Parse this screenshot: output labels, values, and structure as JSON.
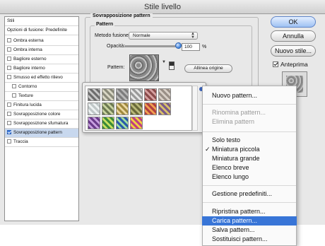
{
  "window": {
    "title": "Stile livello"
  },
  "left_panel": {
    "items": [
      {
        "label": "Stili",
        "checkbox": false,
        "checked": false
      },
      {
        "label": "Opzioni di fusione: Predefinite",
        "checkbox": false,
        "checked": false
      },
      {
        "label": "Ombra esterna",
        "checkbox": true,
        "checked": false
      },
      {
        "label": "Ombra interna",
        "checkbox": true,
        "checked": false
      },
      {
        "label": "Bagliore esterno",
        "checkbox": true,
        "checked": false
      },
      {
        "label": "Bagliore interno",
        "checkbox": true,
        "checked": false
      },
      {
        "label": "Smusso ed effetto rilievo",
        "checkbox": true,
        "checked": false
      },
      {
        "label": "Contorno",
        "checkbox": true,
        "checked": false
      },
      {
        "label": "Texture",
        "checkbox": true,
        "checked": false
      },
      {
        "label": "Finitura lucida",
        "checkbox": true,
        "checked": false
      },
      {
        "label": "Sovrapposizione colore",
        "checkbox": true,
        "checked": false
      },
      {
        "label": "Sovrapposizione sfumatura",
        "checkbox": true,
        "checked": false
      },
      {
        "label": "Sovrapposizione pattern",
        "checkbox": true,
        "checked": true
      },
      {
        "label": "Traccia",
        "checkbox": true,
        "checked": false
      }
    ]
  },
  "panel": {
    "group_title": "Sovrapposizione pattern",
    "sub_title": "Pattern",
    "blend_label": "Metodo fusione:",
    "blend_value": "Normale",
    "opacity_label": "Opacità:",
    "opacity_value": "100",
    "opacity_unit": "%",
    "opacity_level": 1.0,
    "pattern_label": "Pattern:",
    "snap_button": "Allinea origine"
  },
  "buttons": {
    "ok": "OK",
    "cancel": "Annulla",
    "new_style": "Nuovo stile...",
    "preview_label": "Anteprima",
    "preview_checked": true
  },
  "picker_tiles": [
    {
      "c1": "#6d6d6d",
      "c2": "#c7c7c7"
    },
    {
      "c1": "#8b8b7a",
      "c2": "#d8d6c4"
    },
    {
      "c1": "#7c7c7c",
      "c2": "#b8b8b8"
    },
    {
      "c1": "#9a9a9a",
      "c2": "#e6e6e6"
    },
    {
      "c1": "#8b4b4b",
      "c2": "#d6a0a0"
    },
    {
      "c1": "#9a8f86",
      "c2": "#d9cfc6"
    },
    {
      "c1": "#c0c8c8",
      "c2": "#eef2f2"
    },
    {
      "c1": "#6d7a52",
      "c2": "#c8d2a0"
    },
    {
      "c1": "#a08a40",
      "c2": "#ead7a0"
    },
    {
      "c1": "#6a6a3a",
      "c2": "#b8b878"
    },
    {
      "c1": "#b04040",
      "c2": "#f0a050"
    },
    {
      "c1": "#7a5a8a",
      "c2": "#d8c06a"
    },
    {
      "c1": "#6a3a8a",
      "c2": "#c8a0e0"
    },
    {
      "c1": "#3a8a3a",
      "c2": "#c8e060"
    },
    {
      "c1": "#2a5aaa",
      "c2": "#a0e0a0"
    },
    {
      "c1": "#c04080",
      "c2": "#f0d040"
    }
  ],
  "menu": {
    "items": [
      {
        "label": "Nuovo pattern...",
        "state": "normal",
        "check": ""
      },
      {
        "label": "Rinomina pattern...",
        "state": "disabled",
        "check": ""
      },
      {
        "label": "Elimina pattern",
        "state": "disabled",
        "check": ""
      },
      {
        "label": "Solo testo",
        "state": "normal",
        "check": ""
      },
      {
        "label": "Miniatura piccola",
        "state": "normal",
        "check": "✓"
      },
      {
        "label": "Miniatura grande",
        "state": "normal",
        "check": ""
      },
      {
        "label": "Elenco breve",
        "state": "normal",
        "check": ""
      },
      {
        "label": "Elenco lungo",
        "state": "normal",
        "check": ""
      },
      {
        "label": "Gestione predefiniti...",
        "state": "normal",
        "check": ""
      },
      {
        "label": "Ripristina pattern...",
        "state": "normal",
        "check": ""
      },
      {
        "label": "Carica pattern...",
        "state": "highlighted",
        "check": ""
      },
      {
        "label": "Salva pattern...",
        "state": "normal",
        "check": ""
      },
      {
        "label": "Sostituisci pattern...",
        "state": "normal",
        "check": ""
      }
    ]
  }
}
